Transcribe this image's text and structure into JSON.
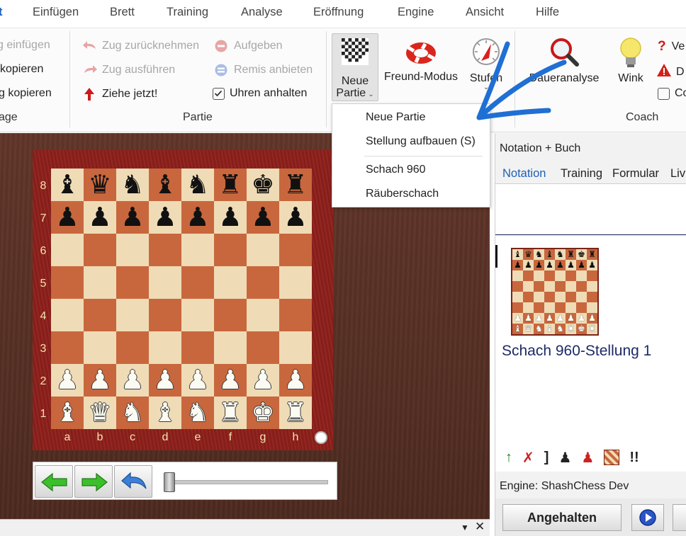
{
  "menu": [
    "t",
    "Einfügen",
    "Brett",
    "Training",
    "Analyse",
    "Eröffnung",
    "Engine",
    "Ansicht",
    "Hilfe"
  ],
  "ribbon": {
    "clip": {
      "paste": "g einfügen",
      "copy": "kopieren",
      "copy2": "g kopieren",
      "group": "age"
    },
    "partie": {
      "takeback": "Zug zurücknehmen",
      "resign": "Aufgeben",
      "redo": "Zug ausführen",
      "draw": "Remis anbieten",
      "movenow": "Ziehe jetzt!",
      "stopclocks": "Uhren anhalten",
      "group": "Partie"
    },
    "newgame_line1": "Neue",
    "newgame_line2": "Partie",
    "friend": "Freund-Modus",
    "levels": "Stufen",
    "coach": {
      "analysis": "Daueranalyse",
      "hint": "Wink",
      "v": "Ve",
      "d": "D",
      "c": "Co",
      "group": "Coach"
    }
  },
  "dropdown": [
    "Neue Partie",
    "Stellung aufbauen (S)",
    "Schach 960",
    "Räuberschach"
  ],
  "board": {
    "ranks": [
      "8",
      "7",
      "6",
      "5",
      "4",
      "3",
      "2",
      "1"
    ],
    "files": [
      "a",
      "b",
      "c",
      "d",
      "e",
      "f",
      "g",
      "h"
    ],
    "rows": [
      [
        "bB",
        "bQ",
        "bN",
        "bB",
        "bN",
        "bR",
        "bK",
        "bR"
      ],
      [
        "bP",
        "bP",
        "bP",
        "bP",
        "bP",
        "bP",
        "bP",
        "bP"
      ],
      [
        "",
        "",
        "",
        "",
        "",
        "",
        "",
        ""
      ],
      [
        "",
        "",
        "",
        "",
        "",
        "",
        "",
        ""
      ],
      [
        "",
        "",
        "",
        "",
        "",
        "",
        "",
        ""
      ],
      [
        "",
        "",
        "",
        "",
        "",
        "",
        "",
        ""
      ],
      [
        "wP",
        "wP",
        "wP",
        "wP",
        "wP",
        "wP",
        "wP",
        "wP"
      ],
      [
        "wB",
        "wQ",
        "wN",
        "wB",
        "wN",
        "wR",
        "wK",
        "wR"
      ]
    ]
  },
  "notation": {
    "panel_title": "Notation + Buch",
    "tabs": [
      "Notation",
      "Training",
      "Formular",
      "Liv"
    ],
    "game_title": "Schach 960-Stellung 1"
  },
  "engine": {
    "title": "Engine: ShashChess Dev",
    "halt": "Angehalten"
  },
  "colors": {
    "link": "#1d5fb8",
    "arrow": "#1f6fd4",
    "dark_square": "#c8673d",
    "light_square": "#efdcb6"
  },
  "toolbar_icons": [
    "up-arrow-icon",
    "cross-arrow-icon",
    "bracket-icon",
    "pawn-icon",
    "pawn-red-icon",
    "board-icon",
    "double-exclam-icon"
  ]
}
